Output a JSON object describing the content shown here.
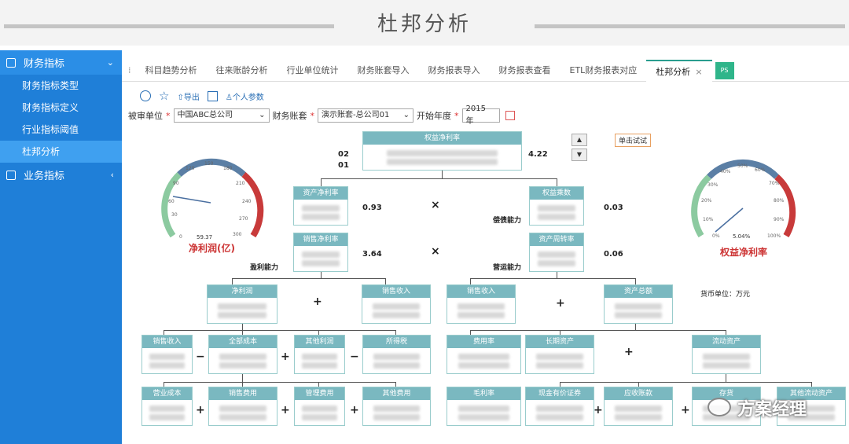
{
  "banner": {
    "title": "杜邦分析"
  },
  "sidebar": {
    "group1": {
      "label": "财务指标",
      "arrow": "⌄"
    },
    "items": [
      {
        "label": "财务指标类型"
      },
      {
        "label": "财务指标定义"
      },
      {
        "label": "行业指标阈值"
      },
      {
        "label": "杜邦分析"
      }
    ],
    "group2": {
      "label": "业务指标",
      "arrow": "‹"
    }
  },
  "tabs": [
    "科目趋势分析",
    "往来账龄分析",
    "行业单位统计",
    "财务账套导入",
    "财务报表导入",
    "财务报表查看",
    "ETL财务报表对应",
    "杜邦分析"
  ],
  "tab_close": "×",
  "toolbar": {
    "export": "导出",
    "personal": "个人参数"
  },
  "filters": {
    "unit_label": "被审单位",
    "unit_value": "中国ABC总公司",
    "book_label": "财务账套",
    "book_value": "演示账套-总公司01",
    "year_label": "开始年度",
    "year_value": "2015 年",
    "req": "*"
  },
  "gauge_left": {
    "label": "净利润(亿)",
    "value": "59.37",
    "ticks": [
      "0",
      "30",
      "60",
      "90",
      "120",
      "150",
      "180",
      "210",
      "240",
      "270",
      "300"
    ]
  },
  "gauge_right": {
    "label": "权益净利率",
    "value": "5.04%",
    "ticks": [
      "0%",
      "10%",
      "20%",
      "30%",
      "40%",
      "50%",
      "60%",
      "70%",
      "80%",
      "90%",
      "100%"
    ]
  },
  "tree": {
    "roe": "权益净利率",
    "roa": "资产净利率",
    "equity_mult": "权益乘数",
    "npm": "销售净利率",
    "turnover": "资产周转率",
    "net_profit": "净利润",
    "sales_rev": "销售收入",
    "sales_rev2": "销售收入",
    "total_assets": "资产总额",
    "sales_rev3": "销售收入",
    "total_cost": "全部成本",
    "other_profit": "其他利润",
    "income_tax": "所得税",
    "expense_rate": "费用率",
    "long_assets": "长期资产",
    "current_assets": "流动资产",
    "op_cost": "营业成本",
    "sell_exp": "销售费用",
    "admin_exp": "管理费用",
    "other_exp": "其他费用",
    "gross_margin": "毛利率",
    "cash": "现金有价证券",
    "receivable": "应收账款",
    "inventory": "存货",
    "other_current": "其他流动资产"
  },
  "values": {
    "v02": "02",
    "v01": "01",
    "v422": "4.22",
    "v093": "0.93",
    "v003": "0.03",
    "v364": "3.64",
    "v006": "0.06"
  },
  "labels": {
    "debt": "偿债能力",
    "profit": "盈利能力",
    "operate": "营运能力",
    "currency": "货币单位：万元",
    "callout": "单击试试"
  },
  "ops": {
    "times": "×",
    "plus": "+",
    "minus": "−"
  },
  "watermark": "方案经理"
}
